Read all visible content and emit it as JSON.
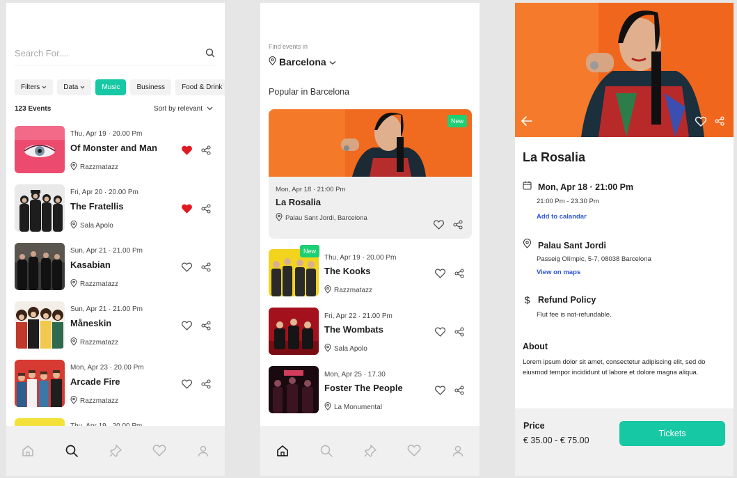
{
  "accent": "#17c8a4",
  "screen1": {
    "search": {
      "placeholder": "Search For....",
      "value": ""
    },
    "filters": [
      {
        "label": "Filters",
        "dropdown": true,
        "active": false
      },
      {
        "label": "Data",
        "dropdown": true,
        "active": false
      },
      {
        "label": "Music",
        "dropdown": false,
        "active": true
      },
      {
        "label": "Business",
        "dropdown": false,
        "active": false
      },
      {
        "label": "Food & Drink",
        "dropdown": false,
        "active": false
      }
    ],
    "events_count": "123 Events",
    "sort_label": "Sort by relevant",
    "events": [
      {
        "date": "Thu, Apr 19 · 20.00 Pm",
        "title": "Of Monster and Man",
        "venue": "Razzmatazz",
        "favorited": true,
        "thumb": "pink-eye"
      },
      {
        "date": "Fri, Apr 20 · 20.00 Pm",
        "title": "The Fratellis",
        "venue": "Sala Apolo",
        "favorited": true,
        "thumb": "white-band"
      },
      {
        "date": "Sun, Apr 21 · 21.00 Pm",
        "title": "Kasabian",
        "venue": "Razzmatazz",
        "favorited": false,
        "thumb": "dark-band"
      },
      {
        "date": "Sun, Apr 21 · 21.00 Pm",
        "title": "Måneskin",
        "venue": "Razzmatazz",
        "favorited": false,
        "thumb": "colorful-band"
      },
      {
        "date": "Mon, Apr 23 · 20.00 Pm",
        "title": "Arcade Fire",
        "venue": "Razzmatazz",
        "favorited": false,
        "thumb": "red-band"
      }
    ],
    "partial_event_date": "Thu, Apr 19 · 20.00 Pm",
    "nav": [
      "home-icon",
      "search-icon",
      "pin-icon",
      "heart-icon",
      "user-icon"
    ],
    "nav_active": "search-icon"
  },
  "screen2": {
    "find_label": "Find events in",
    "city": "Barcelona",
    "popular_label": "Popular in Barcelona",
    "featured": {
      "badge": "New",
      "date": "Mon, Apr 18 · 21:00 Pm",
      "title": "La Rosalia",
      "venue": "Palau Sant Jordi, Barcelona"
    },
    "events": [
      {
        "badge": "New",
        "date": "Thu, Apr 19 · 20.00 Pm",
        "title": "The Kooks",
        "venue": "Razzmatazz",
        "thumb": "yellow-band"
      },
      {
        "badge": "",
        "date": "Fri, Apr 22 · 21.00 Pm",
        "title": "The Wombats",
        "venue": "Sala Apolo",
        "thumb": "red-room"
      },
      {
        "badge": "",
        "date": "Mon, Apr 25  · 17.30",
        "title": "Foster The People",
        "venue": "La Monumental",
        "thumb": "neon-room"
      }
    ],
    "nav_active": "home-icon"
  },
  "screen3": {
    "title": "La Rosalia",
    "date": "Mon, Apr 18 · 21:00 Pm",
    "time_range": "21:00 Pm - 23.30 Pm",
    "add_calendar": "Add to calandar",
    "venue": "Palau Sant Jordi",
    "address": "Passeig Olímpic, 5-7, 08038 Barcelona",
    "maps_link": "View on maps",
    "refund_title": "Refund Policy",
    "refund_text": "Flut fee is not-refundable.",
    "about_title": "About",
    "about_text": "Lorem ipsum dolor sit amet, consectetur adipiscing elit, sed do eiusmod tempor incididunt ut labore et dolore magna aliqua.",
    "price_label": "Price",
    "price_value": "€ 35.00 - € 75.00",
    "tickets_label": "Tickets"
  }
}
